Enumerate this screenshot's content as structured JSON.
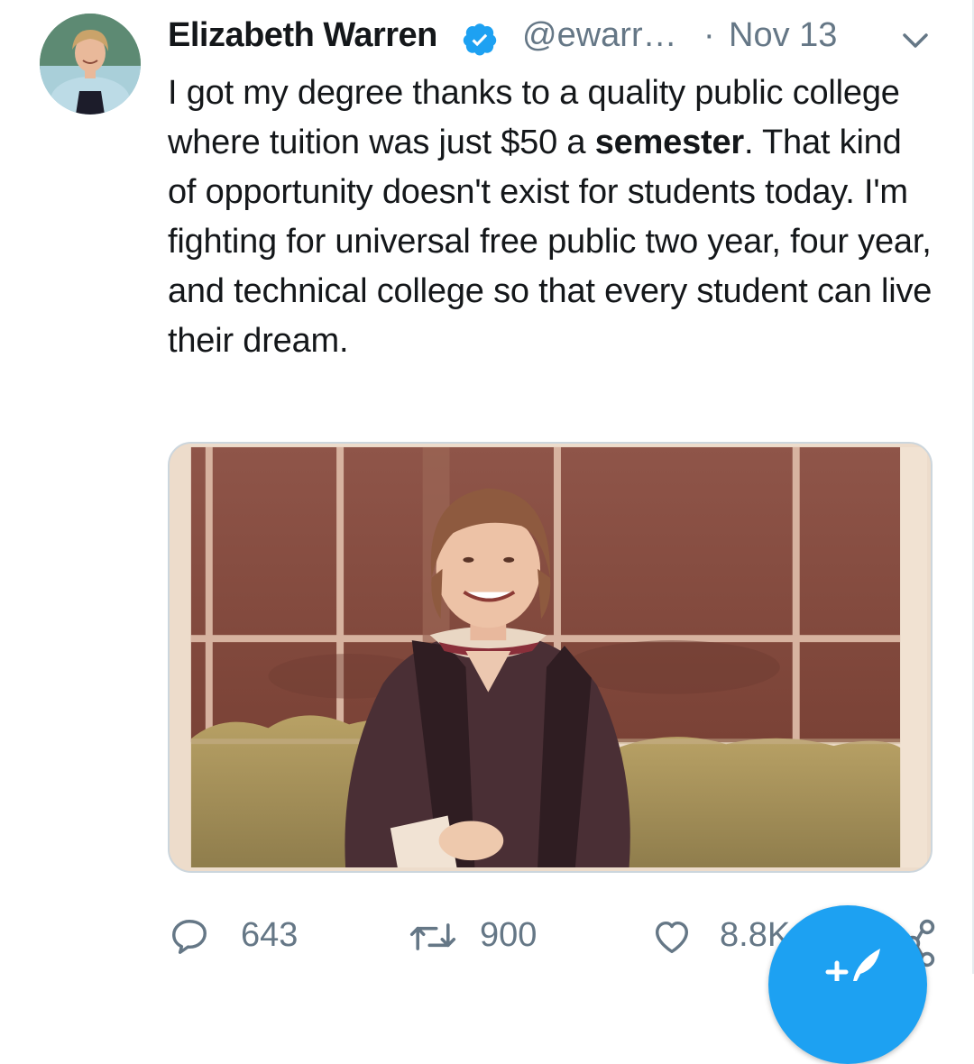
{
  "tweet": {
    "author_name": "Elizabeth Warren",
    "handle": "@ewarr…",
    "separator": "·",
    "date": "Nov 13",
    "text_before_bold": "I got my degree thanks to a quality public college where tuition was just $50 a ",
    "text_bold": "semester",
    "text_after_bold": ". That kind of opportunity doesn't exist for students today. I'm fighting for universal free public two year, four year, and technical college so that every student can live their dream.",
    "verified": true
  },
  "actions": {
    "reply_count": "643",
    "retweet_count": "900",
    "like_count": "8.8K"
  },
  "icons": {
    "verified": "verified-badge-icon",
    "caret": "chevron-down-icon",
    "reply": "reply-icon",
    "retweet": "retweet-icon",
    "like": "heart-icon",
    "share": "share-icon",
    "compose": "compose-tweet-icon"
  },
  "colors": {
    "accent": "#1da1f2",
    "text_primary": "#14171a",
    "text_secondary": "#657786",
    "border": "#ccd6dd"
  }
}
